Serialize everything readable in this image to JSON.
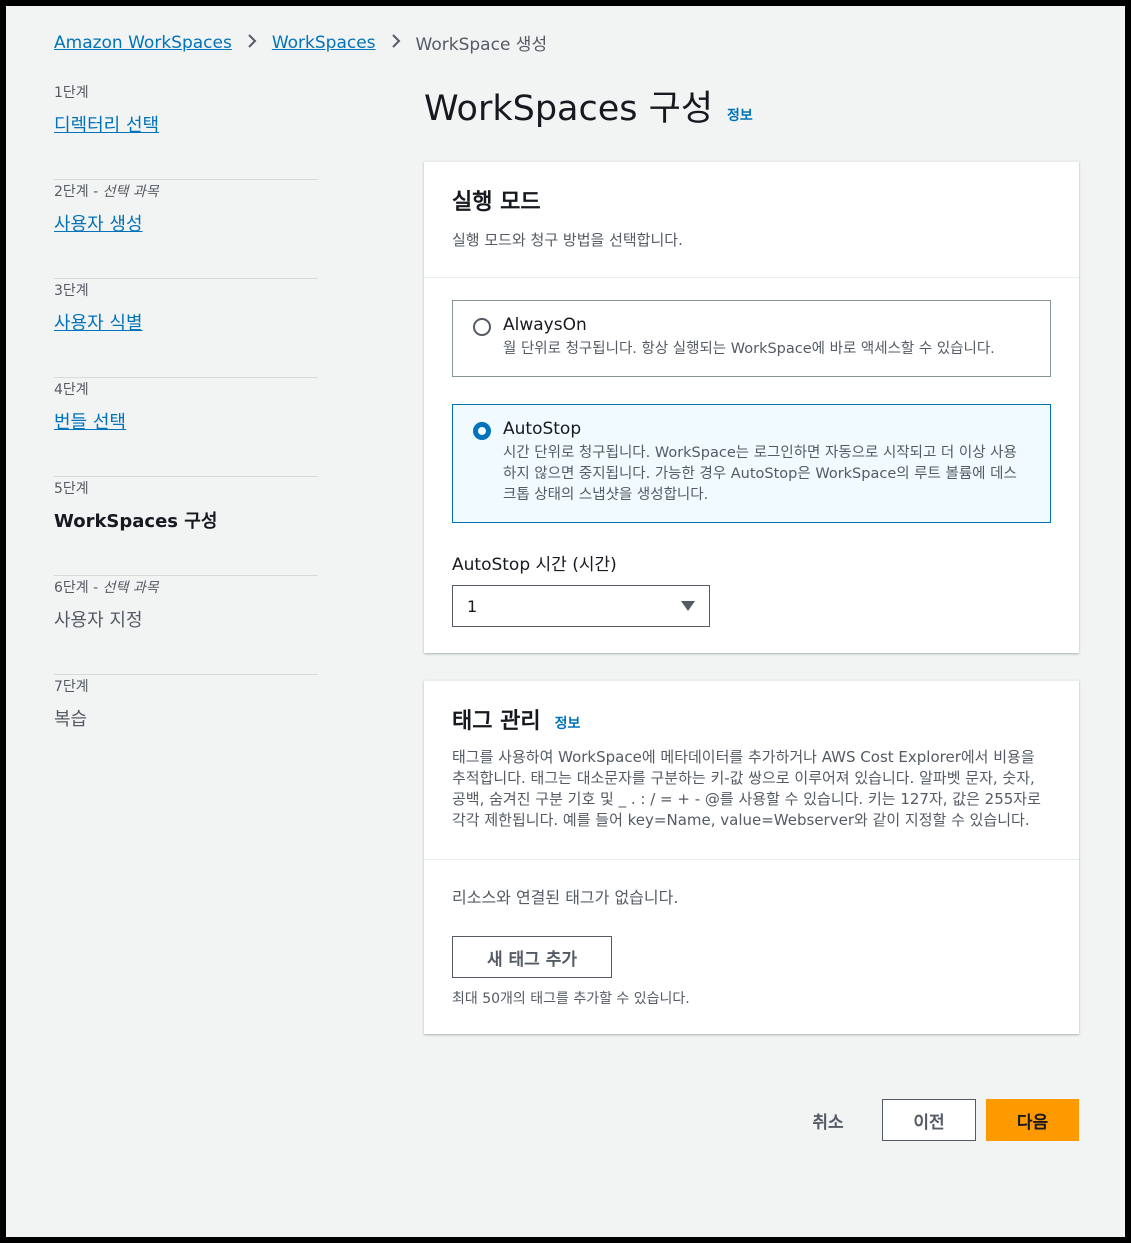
{
  "breadcrumb": {
    "item1": "Amazon WorkSpaces",
    "item2": "WorkSpaces",
    "current": "WorkSpace 생성"
  },
  "steps": [
    {
      "num": "1단계",
      "optional": "",
      "name": "디렉터리 선택"
    },
    {
      "num": "2단계",
      "optional": "선택 과목",
      "name": "사용자 생성"
    },
    {
      "num": "3단계",
      "optional": "",
      "name": "사용자 식별"
    },
    {
      "num": "4단계",
      "optional": "",
      "name": "번들 선택"
    },
    {
      "num": "5단계",
      "optional": "",
      "name": "WorkSpaces 구성"
    },
    {
      "num": "6단계",
      "optional": "선택 과목",
      "name": "사용자 지정"
    },
    {
      "num": "7단계",
      "optional": "",
      "name": "복습"
    }
  ],
  "page": {
    "title": "WorkSpaces 구성",
    "info": "정보"
  },
  "running_mode": {
    "title": "실행 모드",
    "description": "실행 모드와 청구 방법을 선택합니다.",
    "options": [
      {
        "label": "AlwaysOn",
        "desc": "월 단위로 청구됩니다. 항상 실행되는 WorkSpace에 바로 액세스할 수 있습니다.",
        "selected": false
      },
      {
        "label": "AutoStop",
        "desc": "시간 단위로 청구됩니다. WorkSpace는 로그인하면 자동으로 시작되고 더 이상 사용하지 않으면 중지됩니다. 가능한 경우 AutoStop은 WorkSpace의 루트 볼륨에 데스크톱 상태의 스냅샷을 생성합니다.",
        "selected": true
      }
    ],
    "autostop_label": "AutoStop 시간 (시간)",
    "autostop_value": "1"
  },
  "tags": {
    "title": "태그 관리",
    "info": "정보",
    "description": "태그를 사용하여 WorkSpace에 메타데이터를 추가하거나 AWS Cost Explorer에서 비용을 추적합니다. 태그는 대소문자를 구분하는 키-값 쌍으로 이루어져 있습니다. 알파벳 문자, 숫자, 공백, 숨겨진 구분 기호 및 _ . : / = + - @를 사용할 수 있습니다. 키는 127자, 값은 255자로 각각 제한됩니다. 예를 들어 key=Name, value=Webserver와 같이 지정할 수 있습니다.",
    "empty": "리소스와 연결된 태그가 없습니다.",
    "add_button": "새 태그 추가",
    "limit_note": "최대 50개의 태그를 추가할 수 있습니다."
  },
  "footer": {
    "cancel": "취소",
    "previous": "이전",
    "next": "다음"
  },
  "colors": {
    "link": "#0073bb",
    "primary": "#ff9900",
    "selected_bg": "#f1faff",
    "background": "#f2f3f3"
  }
}
